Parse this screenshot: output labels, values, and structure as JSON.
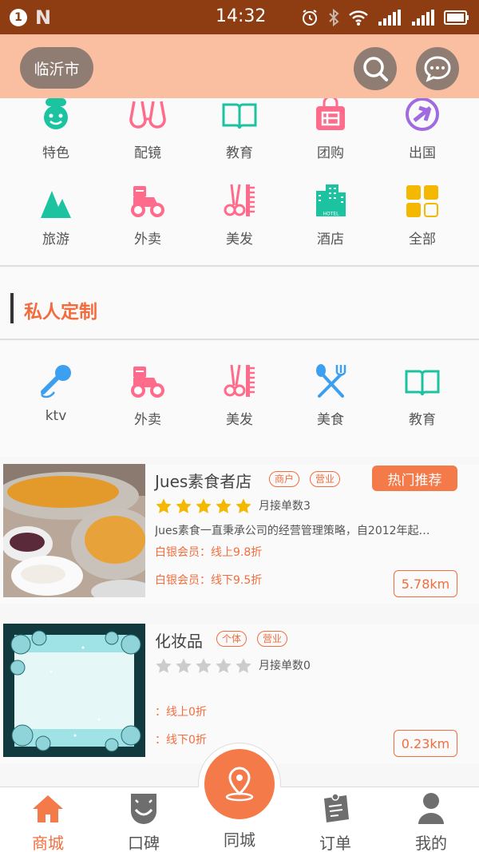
{
  "status_bar": {
    "notification_count": "1",
    "n_label": "N",
    "time": "14:32"
  },
  "header": {
    "city": "临沂市",
    "search_icon": "search-icon",
    "message_icon": "message-icon"
  },
  "categories": [
    {
      "label": "特色",
      "icon": "chef-icon",
      "color": "#1cc3a0"
    },
    {
      "label": "配镜",
      "icon": "glasses-icon",
      "color": "#ff6b8b"
    },
    {
      "label": "教育",
      "icon": "book-icon",
      "color": "#1cc3a0"
    },
    {
      "label": "团购",
      "icon": "group-buy-icon",
      "color": "#ff6b8b"
    },
    {
      "label": "出国",
      "icon": "plane-icon",
      "color": "#a06be0"
    },
    {
      "label": "旅游",
      "icon": "mountain-icon",
      "color": "#1cc3a0"
    },
    {
      "label": "外卖",
      "icon": "scooter-icon",
      "color": "#ff6b8b"
    },
    {
      "label": "美发",
      "icon": "scissors-comb-icon",
      "color": "#ff6b8b"
    },
    {
      "label": "酒店",
      "icon": "hotel-icon",
      "color": "#1cc3a0"
    },
    {
      "label": "全部",
      "icon": "grid-icon",
      "color": "#f5b800"
    }
  ],
  "hotel_sign": "HOTEL",
  "section": {
    "title": "私人定制"
  },
  "private_categories": [
    {
      "label": "ktv",
      "icon": "microphone-icon",
      "color": "#3d9ff0"
    },
    {
      "label": "外卖",
      "icon": "scooter-icon",
      "color": "#ff6b8b"
    },
    {
      "label": "美发",
      "icon": "scissors-comb-icon",
      "color": "#ff6b8b"
    },
    {
      "label": "美食",
      "icon": "fork-spoon-icon",
      "color": "#3d9ff0"
    },
    {
      "label": "教育",
      "icon": "book-icon",
      "color": "#1cc3a0"
    }
  ],
  "shops": [
    {
      "name": "Jues素食者店",
      "tags": [
        "商户",
        "营业"
      ],
      "hot_label": "热门推荐",
      "rating": 5,
      "rating_max": 5,
      "monthly": "月接单数3",
      "desc": "Jues素食一直秉承公司的经营管理策略，自2012年起…",
      "member_online": "白银会员：线上9.8折",
      "member_offline": "白银会员：线下9.5折",
      "distance": "5.78km"
    },
    {
      "name": "化妆品",
      "tags": [
        "个体",
        "营业"
      ],
      "rating": 0,
      "rating_max": 5,
      "monthly": "月接单数0",
      "member_online": "：线上0折",
      "member_offline": "：线下0折",
      "distance": "0.23km"
    }
  ],
  "tabbar": {
    "tabs": [
      {
        "label": "商城",
        "icon": "home-icon",
        "active": true
      },
      {
        "label": "口碑",
        "icon": "face-icon",
        "active": false
      },
      {
        "label": "同城",
        "icon": "location-pin-icon",
        "active": false
      },
      {
        "label": "订单",
        "icon": "order-icon",
        "active": false
      },
      {
        "label": "我的",
        "icon": "user-icon",
        "active": false
      }
    ]
  },
  "colors": {
    "accent": "#f26d3d",
    "status_bar": "#8e3d12",
    "header": "#f9bfa0",
    "star_on": "#f5b800",
    "star_off": "#cccccc"
  }
}
